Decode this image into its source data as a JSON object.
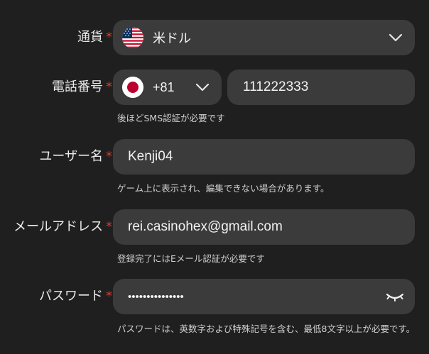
{
  "required_mark": "*",
  "currency": {
    "label": "通貨",
    "value": "米ドル",
    "flag_icon": "us-flag-icon"
  },
  "phone": {
    "label": "電話番号",
    "country_code": "+81",
    "flag_icon": "japan-flag-icon",
    "number": "111222333",
    "hint": "後ほどSMS認証が必要です"
  },
  "username": {
    "label": "ユーザー名",
    "value": "Kenji04",
    "hint": "ゲーム上に表示され、編集できない場合があります。"
  },
  "email": {
    "label": "メールアドレス",
    "value": "rei.casinohex@gmail.com",
    "hint": "登録完了にはEメール認証が必要です"
  },
  "password": {
    "label": "パスワード",
    "value": "•••••••••••••••",
    "hint": "パスワードは、英数字および特殊記号を含む、最低8文字以上が必要です。"
  },
  "colors": {
    "background": "#1f1f1f",
    "field": "#3b3b3b",
    "required": "#e03a2f",
    "hint": "#cfcfcf"
  }
}
